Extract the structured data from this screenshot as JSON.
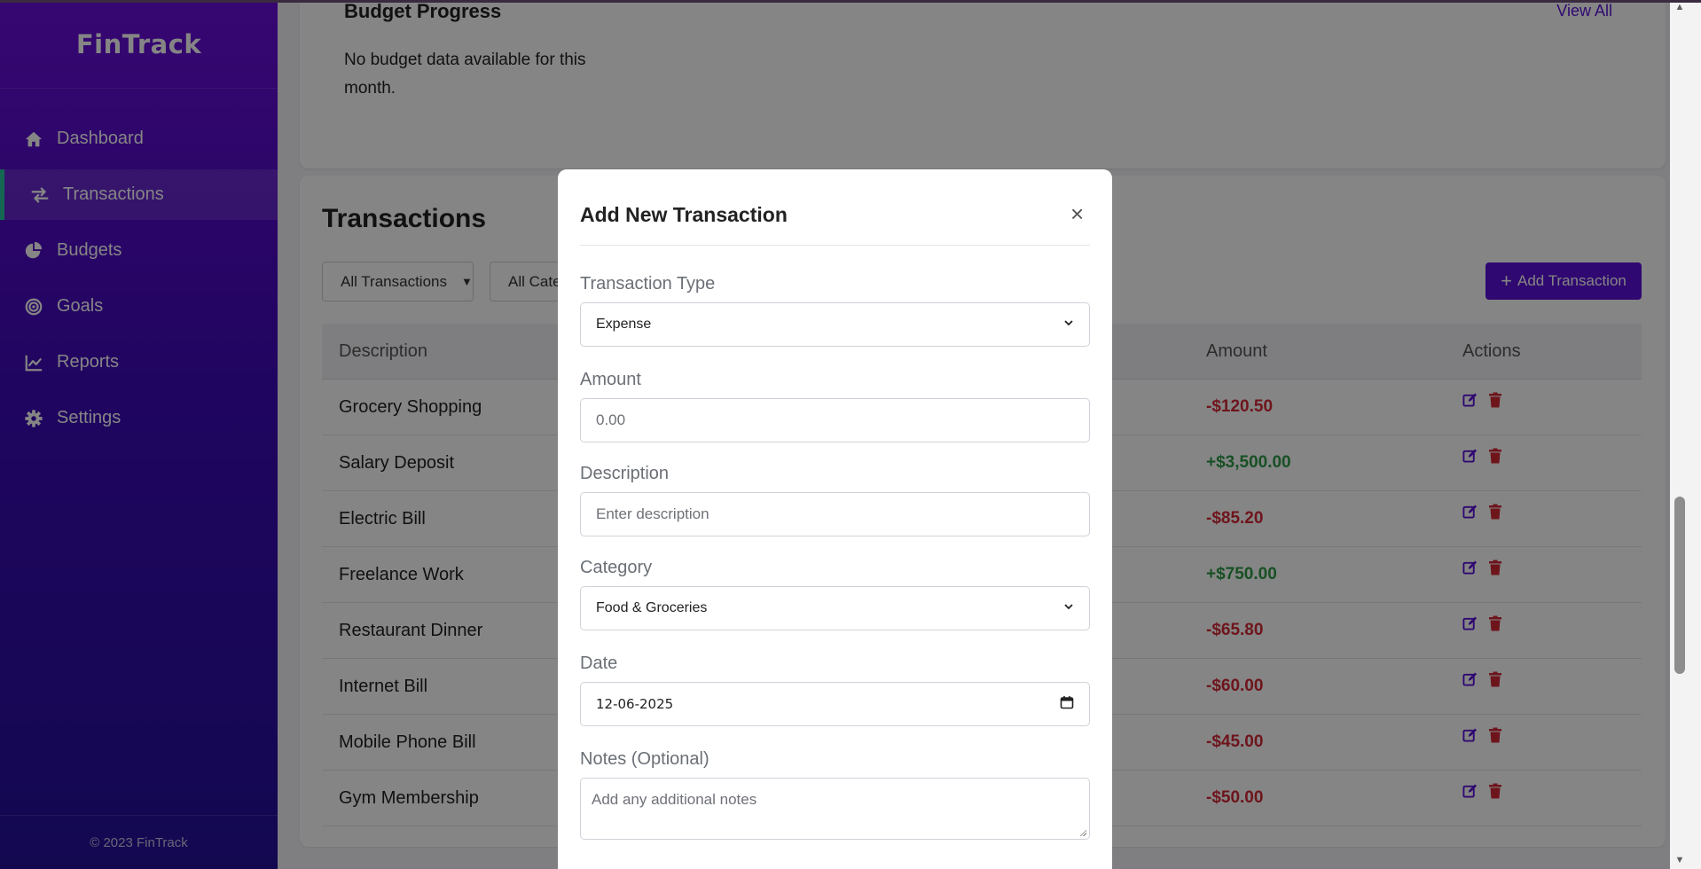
{
  "sidebar": {
    "brand": "FinTrack",
    "items": [
      {
        "label": "Dashboard",
        "icon": "home-icon"
      },
      {
        "label": "Transactions",
        "icon": "exchange-icon",
        "active": true
      },
      {
        "label": "Budgets",
        "icon": "pie-chart-icon"
      },
      {
        "label": "Goals",
        "icon": "target-icon"
      },
      {
        "label": "Reports",
        "icon": "line-chart-icon"
      },
      {
        "label": "Settings",
        "icon": "gear-icon"
      }
    ],
    "footer": "© 2023 FinTrack"
  },
  "budget": {
    "title": "Budget Progress",
    "view_all": "View All",
    "empty_message": "No budget data available for this month."
  },
  "transactions": {
    "title": "Transactions",
    "filters": {
      "type": "All Transactions",
      "category": "All Cate"
    },
    "add_button": "Add Transaction",
    "columns": {
      "description": "Description",
      "amount": "Amount",
      "actions": "Actions"
    },
    "rows": [
      {
        "description": "Grocery Shopping",
        "amount": "-$120.50",
        "sign": "neg"
      },
      {
        "description": "Salary Deposit",
        "amount": "+$3,500.00",
        "sign": "pos"
      },
      {
        "description": "Electric Bill",
        "amount": "-$85.20",
        "sign": "neg"
      },
      {
        "description": "Freelance Work",
        "amount": "+$750.00",
        "sign": "pos"
      },
      {
        "description": "Restaurant Dinner",
        "amount": "-$65.80",
        "sign": "neg"
      },
      {
        "description": "Internet Bill",
        "amount": "-$60.00",
        "sign": "neg"
      },
      {
        "description": "Mobile Phone Bill",
        "amount": "-$45.00",
        "sign": "neg"
      },
      {
        "description": "Gym Membership",
        "amount": "-$50.00",
        "sign": "neg"
      }
    ]
  },
  "modal": {
    "title": "Add New Transaction",
    "close": "×",
    "type_label": "Transaction Type",
    "type_value": "Expense",
    "amount_label": "Amount",
    "amount_placeholder": "0.00",
    "description_label": "Description",
    "description_placeholder": "Enter description",
    "category_label": "Category",
    "category_value": "Food & Groceries",
    "date_label": "Date",
    "date_value": "12-06-2025",
    "notes_label": "Notes (Optional)",
    "notes_placeholder": "Add any additional notes"
  },
  "colors": {
    "accent": "#5b10d8",
    "sidebar_top": "#6a0dda",
    "sidebar_bottom": "#24109a",
    "negative": "#d42a36",
    "positive": "#2d9a46",
    "active_marker": "#27c8a0"
  }
}
